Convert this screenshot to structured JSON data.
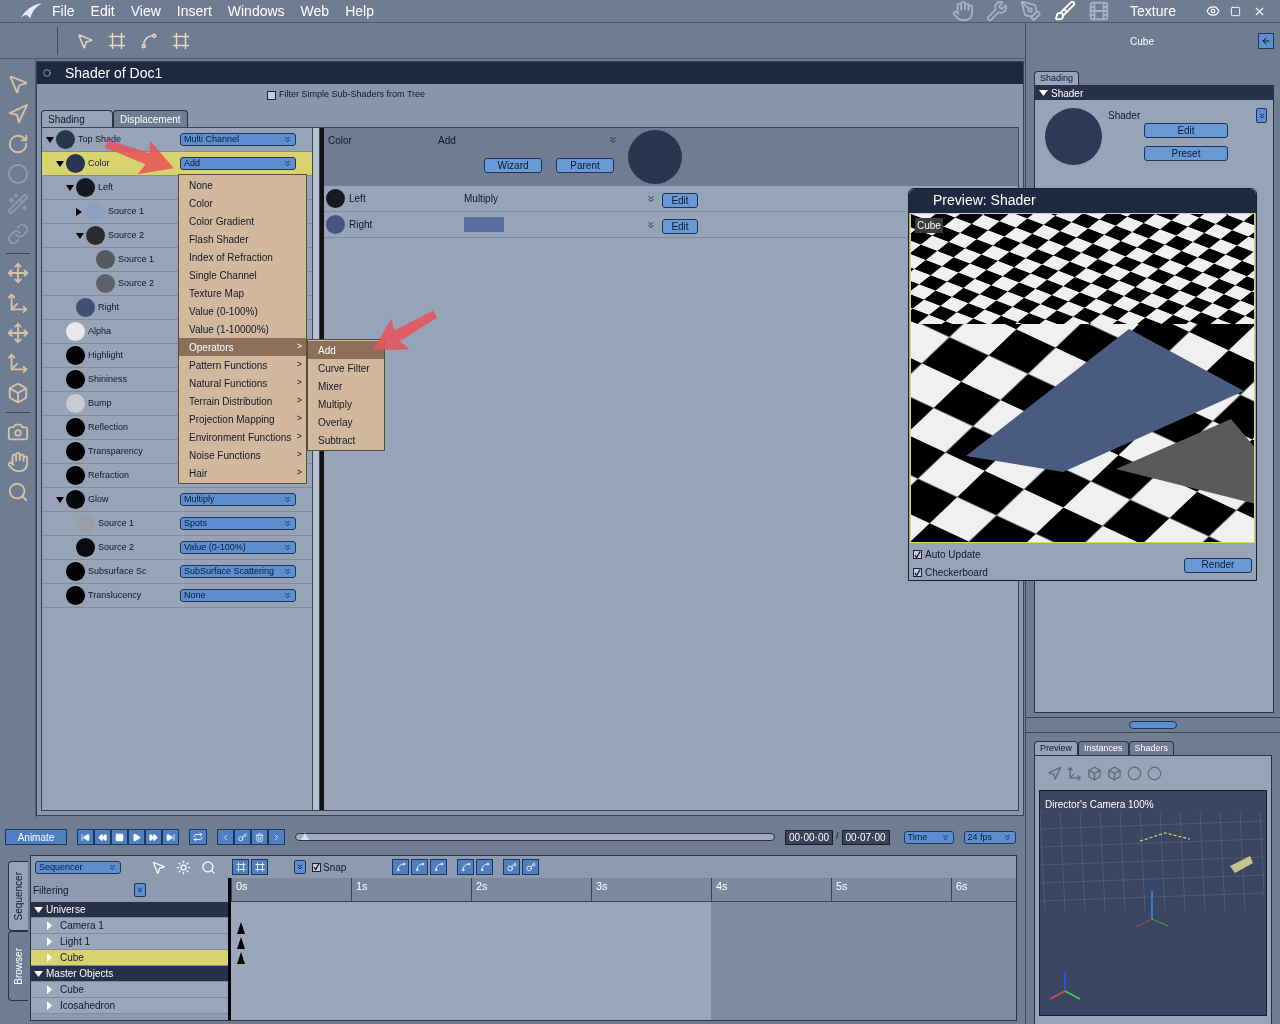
{
  "menu_bar": {
    "items": [
      "File",
      "Edit",
      "View",
      "Insert",
      "Windows",
      "Web",
      "Help"
    ],
    "room": "Texture"
  },
  "toolbar": {
    "object": "Cube"
  },
  "shader_window": {
    "title": "Shader of Doc1",
    "filter": {
      "label": "Filter Simple Sub-Shaders from Tree",
      "checked": false
    },
    "tabs": [
      {
        "label": "Shading",
        "selected": true
      },
      {
        "label": "Displacement",
        "selected": false
      }
    ],
    "tree": [
      {
        "label": "Top Shade",
        "value": "Multi Channel",
        "expanded": true,
        "selected": false,
        "color": "#2a3550",
        "children": [
          {
            "label": "Color",
            "value": "Add",
            "expanded": true,
            "selected": true,
            "color": "#2a3550",
            "children": [
              {
                "label": "Left",
                "expanded": true,
                "selected": false,
                "color": "#15181f",
                "children": [
                  {
                    "label": "Source 1",
                    "expanded": false,
                    "selected": false,
                    "color": "#8c9fc0"
                  },
                  {
                    "label": "Source 2",
                    "expanded": true,
                    "selected": false,
                    "color": "#2a2c30",
                    "children": [
                      {
                        "label": "Source 1",
                        "selected": false,
                        "color": "#555a60"
                      },
                      {
                        "label": "Source 2",
                        "selected": false,
                        "color": "#5e6268"
                      }
                    ]
                  }
                ]
              },
              {
                "label": "Right",
                "selected": false,
                "color": "#3e5078"
              }
            ]
          },
          {
            "label": "Alpha",
            "selected": false,
            "color": "#e8e8e8"
          },
          {
            "label": "Highlight",
            "selected": false,
            "color": "#000000"
          },
          {
            "label": "Shininess",
            "selected": false,
            "color": "#000000"
          },
          {
            "label": "Bump",
            "selected": false,
            "color": "#c8ccd2"
          },
          {
            "label": "Reflection",
            "selected": false,
            "color": "#000000"
          },
          {
            "label": "Transparency",
            "selected": false,
            "color": "#000000"
          },
          {
            "label": "Refraction",
            "selected": false,
            "color": "#000000"
          },
          {
            "label": "Glow",
            "value": "Multiply",
            "expanded": true,
            "selected": false,
            "color": "#08090c",
            "children": [
              {
                "label": "Source 1",
                "value": "Spots",
                "selected": false,
                "color": "#9a9ea4"
              },
              {
                "label": "Source 2",
                "value": "Value (0-100%)",
                "selected": false,
                "color": "#0a0b0e"
              }
            ]
          },
          {
            "label": "Subsurface Sc",
            "value": "SubSurface Scattering",
            "selected": false,
            "color": "#000000"
          },
          {
            "label": "Translucency",
            "value": "None",
            "selected": false,
            "color": "#000000"
          }
        ]
      }
    ],
    "menu": {
      "items": [
        {
          "label": "None",
          "submenu": false,
          "selected": false
        },
        {
          "label": "Color",
          "submenu": false,
          "selected": false
        },
        {
          "label": "Color Gradient",
          "submenu": false,
          "selected": false
        },
        {
          "label": "Flash Shader",
          "submenu": false,
          "selected": false
        },
        {
          "label": "Index of Refraction",
          "submenu": false,
          "selected": false
        },
        {
          "label": "Single Channel",
          "submenu": false,
          "selected": false
        },
        {
          "label": "Texture Map",
          "submenu": false,
          "selected": false
        },
        {
          "label": "Value (0-100%)",
          "submenu": false,
          "selected": false
        },
        {
          "label": "Value (1-10000%)",
          "submenu": false,
          "selected": false
        },
        {
          "label": "Operators",
          "submenu": true,
          "selected": true
        },
        {
          "label": "Pattern Functions",
          "submenu": true,
          "selected": false
        },
        {
          "label": "Natural Functions",
          "submenu": true,
          "selected": false
        },
        {
          "label": "Terrain Distribution",
          "submenu": true,
          "selected": false
        },
        {
          "label": "Projection Mapping",
          "submenu": true,
          "selected": false
        },
        {
          "label": "Environment Functions",
          "submenu": true,
          "selected": false
        },
        {
          "label": "Noise Functions",
          "submenu": true,
          "selected": false
        },
        {
          "label": "Hair",
          "submenu": true,
          "selected": false
        }
      ],
      "submenu_arrow": ">",
      "submenu": [
        {
          "label": "Add",
          "selected": true
        },
        {
          "label": "Curve Filter",
          "selected": false
        },
        {
          "label": "Mixer",
          "selected": false
        },
        {
          "label": "Multiply",
          "selected": false
        },
        {
          "label": "Overlay",
          "selected": false
        },
        {
          "label": "Subtract",
          "selected": false
        }
      ]
    },
    "detail": {
      "channel": "Color",
      "type": "Add",
      "buttons": [
        "Wizard",
        "Parent"
      ],
      "rows": [
        {
          "label": "Left",
          "kind": "shader",
          "value": "Multiply",
          "button": "Edit",
          "ball": {
            "color": "#161a24"
          }
        },
        {
          "label": "Right",
          "kind": "swatch",
          "swatch": {
            "color": "#5a6c9e"
          },
          "button": "Edit",
          "ball": {
            "color": "#45577f"
          }
        }
      ]
    }
  },
  "right_panel": {
    "tabs": [
      {
        "label": "Shading",
        "selected": true
      }
    ],
    "section": {
      "title": "Shader",
      "expanded": true,
      "label": "Shader",
      "buttons": [
        "Edit",
        "Preset"
      ]
    }
  },
  "preview_window": {
    "title": "Preview: Shader",
    "object": "Cube",
    "options": [
      {
        "label": "Auto Update",
        "checked": true
      },
      {
        "label": "Checkerboard",
        "checked": true
      }
    ],
    "button": "Render"
  },
  "animation_bar": {
    "mode": "Animate",
    "time_slider": {
      "level": 0.01
    },
    "current_time": "00·00·00",
    "separator": "/",
    "end_time": "00·07·00",
    "time_format": "Time",
    "fps": "24 fps"
  },
  "sequencer": {
    "side_tabs": [
      {
        "label": "Sequencer",
        "selected": true
      },
      {
        "label": "Browser",
        "selected": false
      }
    ],
    "view": "Sequencer",
    "filter": "Filtering",
    "snap": {
      "label": "Snap",
      "checked": true
    },
    "ruler": [
      "0s",
      "1s",
      "2s",
      "3s",
      "4s",
      "5s",
      "6s"
    ],
    "tree": [
      {
        "label": "Universe",
        "expanded": true,
        "children": [
          {
            "label": "Camera 1",
            "selected": false
          },
          {
            "label": "Light 1",
            "selected": false
          },
          {
            "label": "Cube",
            "selected": true
          }
        ]
      },
      {
        "label": "Master Objects",
        "expanded": true,
        "children": [
          {
            "label": "Cube",
            "selected": false
          },
          {
            "label": "Icosahedron",
            "selected": false
          }
        ]
      }
    ]
  },
  "browser_panel": {
    "tabs": [
      {
        "label": "Preview",
        "selected": true
      },
      {
        "label": "Instances",
        "selected": false
      },
      {
        "label": "Shaders",
        "selected": false
      }
    ],
    "viewport_label": "Director's Camera 100%"
  }
}
